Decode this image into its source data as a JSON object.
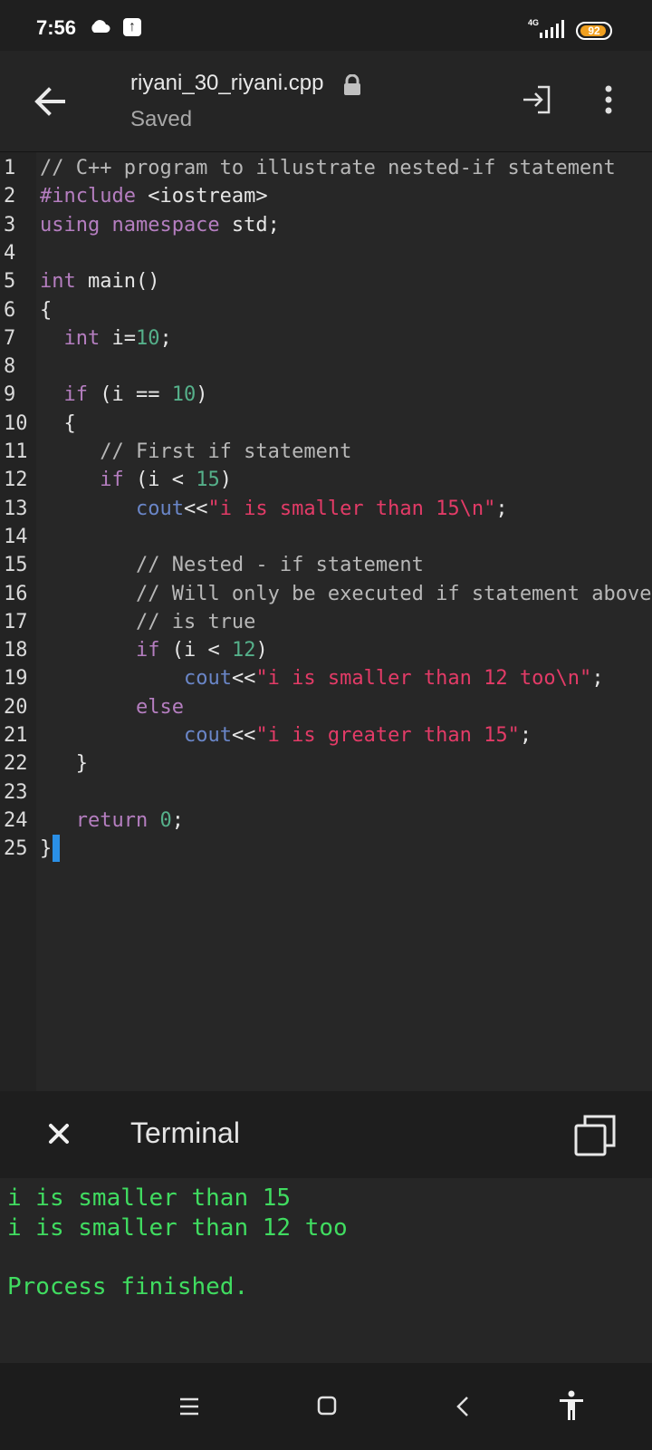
{
  "status": {
    "time": "7:56",
    "network": "4G",
    "battery": "92",
    "battery_level": 0.92
  },
  "header": {
    "title": "riyani_30_riyani.cpp",
    "subtitle": "Saved"
  },
  "editor": {
    "lines": [
      {
        "n": "1",
        "html": "<span class=\"cmt\">// C++ program to illustrate nested-if statement</span>"
      },
      {
        "n": "2",
        "html": "<span class=\"kw\">#include</span> &lt;iostream&gt;"
      },
      {
        "n": "3",
        "html": "<span class=\"kw\">using namespace</span> std;"
      },
      {
        "n": "4",
        "html": ""
      },
      {
        "n": "5",
        "html": "<span class=\"kw\">int</span> main()"
      },
      {
        "n": "6",
        "html": "{"
      },
      {
        "n": "7",
        "html": "  <span class=\"kw\">int</span> i=<span class=\"num\">10</span>;"
      },
      {
        "n": "8",
        "html": ""
      },
      {
        "n": "9",
        "html": "  <span class=\"kw\">if</span> (i == <span class=\"num\">10</span>)"
      },
      {
        "n": "10",
        "html": "  {"
      },
      {
        "n": "11",
        "html": "     <span class=\"cmt\">// First if statement</span>"
      },
      {
        "n": "12",
        "html": "     <span class=\"kw\">if</span> (i &lt; <span class=\"num\">15</span>)"
      },
      {
        "n": "13",
        "html": "        <span class=\"fn\">cout</span>&lt;&lt;<span class=\"str\">\"i is smaller than 15\\n\"</span>;"
      },
      {
        "n": "14",
        "html": ""
      },
      {
        "n": "15",
        "html": "        <span class=\"cmt\">// Nested - if statement</span>"
      },
      {
        "n": "16",
        "html": "        <span class=\"cmt\">// Will only be executed if statement above</span>"
      },
      {
        "n": "17",
        "html": "        <span class=\"cmt\">// is true</span>"
      },
      {
        "n": "18",
        "html": "        <span class=\"kw\">if</span> (i &lt; <span class=\"num\">12</span>)"
      },
      {
        "n": "19",
        "html": "            <span class=\"fn\">cout</span>&lt;&lt;<span class=\"str\">\"i is smaller than 12 too\\n\"</span>;"
      },
      {
        "n": "20",
        "html": "        <span class=\"kw\">else</span>"
      },
      {
        "n": "21",
        "html": "            <span class=\"fn\">cout</span>&lt;&lt;<span class=\"str\">\"i is greater than 15\"</span>;"
      },
      {
        "n": "22",
        "html": "   }"
      },
      {
        "n": "23",
        "html": ""
      },
      {
        "n": "24",
        "html": "   <span class=\"kw\">return</span> <span class=\"num\">0</span>;"
      },
      {
        "n": "25",
        "html": "}",
        "cursor": true
      }
    ]
  },
  "terminal": {
    "title": "Terminal",
    "output": [
      "i is smaller than 15",
      "i is smaller than 12 too",
      "",
      "Process finished."
    ]
  }
}
